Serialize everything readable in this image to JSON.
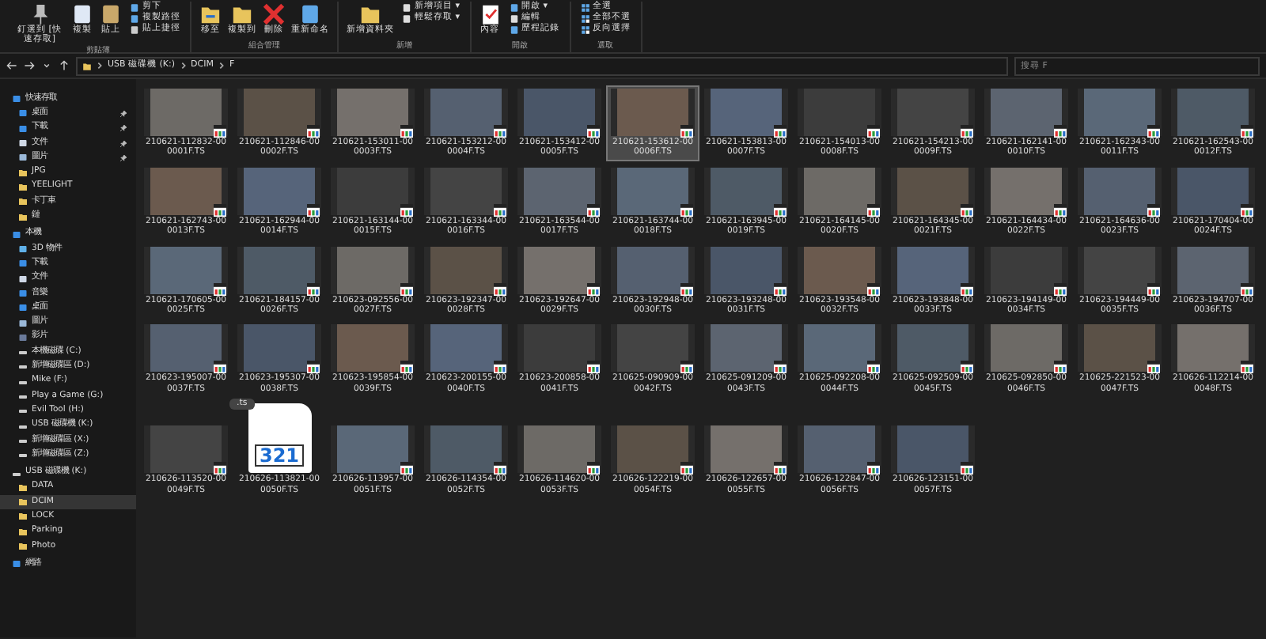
{
  "ribbon": {
    "groups": [
      {
        "label": "剪貼簿",
        "buttons": [
          {
            "kind": "large",
            "label": "釘選到 [快速存取]"
          },
          {
            "kind": "large",
            "label": "複製"
          },
          {
            "kind": "large",
            "label": "貼上"
          },
          {
            "kind": "small",
            "label": "剪下"
          },
          {
            "kind": "small",
            "label": "複製路徑"
          },
          {
            "kind": "small",
            "label": "貼上捷徑"
          }
        ]
      },
      {
        "label": "組合管理",
        "buttons": [
          {
            "kind": "large",
            "label": "移至"
          },
          {
            "kind": "large",
            "label": "複製到"
          },
          {
            "kind": "large",
            "label": "刪除"
          },
          {
            "kind": "large",
            "label": "重新命名"
          }
        ]
      },
      {
        "label": "新增",
        "buttons": [
          {
            "kind": "large",
            "label": "新增資料夾"
          },
          {
            "kind": "small",
            "label": "新增項目 ▾"
          },
          {
            "kind": "small",
            "label": "輕鬆存取 ▾"
          }
        ]
      },
      {
        "label": "開啟",
        "buttons": [
          {
            "kind": "large",
            "label": "內容"
          },
          {
            "kind": "small",
            "label": "開啟 ▾"
          },
          {
            "kind": "small",
            "label": "編輯"
          },
          {
            "kind": "small",
            "label": "歷程記錄"
          }
        ]
      },
      {
        "label": "選取",
        "buttons": [
          {
            "kind": "small",
            "label": "全選"
          },
          {
            "kind": "small",
            "label": "全部不選"
          },
          {
            "kind": "small",
            "label": "反向選擇"
          }
        ]
      }
    ]
  },
  "address_bar": {
    "path": [
      "USB 磁碟機 (K:)",
      "DCIM",
      "F"
    ],
    "search": {
      "placeholder": "搜尋 F"
    }
  },
  "sidebar": {
    "items": [
      {
        "kind": "header",
        "label": "快速存取",
        "selected": false,
        "pinned": false
      },
      {
        "kind": "item",
        "label": "桌面",
        "selected": false,
        "pinned": true
      },
      {
        "kind": "item",
        "label": "下載",
        "selected": false,
        "pinned": true
      },
      {
        "kind": "item",
        "label": "文件",
        "selected": false,
        "pinned": true
      },
      {
        "kind": "item",
        "label": "圖片",
        "selected": false,
        "pinned": true
      },
      {
        "kind": "folder",
        "label": "JPG",
        "selected": false,
        "pinned": false
      },
      {
        "kind": "folder",
        "label": "YEELIGHT",
        "selected": false,
        "pinned": false
      },
      {
        "kind": "folder",
        "label": "卡丁車",
        "selected": false,
        "pinned": false
      },
      {
        "kind": "folder",
        "label": "鏈",
        "selected": false,
        "pinned": false
      },
      {
        "kind": "header",
        "label": "本機",
        "selected": false,
        "pinned": false
      },
      {
        "kind": "item",
        "label": "3D 物件",
        "selected": false,
        "pinned": false
      },
      {
        "kind": "item",
        "label": "下載",
        "selected": false,
        "pinned": false
      },
      {
        "kind": "item",
        "label": "文件",
        "selected": false,
        "pinned": false
      },
      {
        "kind": "item",
        "label": "音樂",
        "selected": false,
        "pinned": false
      },
      {
        "kind": "item",
        "label": "桌面",
        "selected": false,
        "pinned": false
      },
      {
        "kind": "item",
        "label": "圖片",
        "selected": false,
        "pinned": false
      },
      {
        "kind": "item",
        "label": "影片",
        "selected": false,
        "pinned": false
      },
      {
        "kind": "drive",
        "label": "本機磁碟 (C:)",
        "selected": false,
        "pinned": false
      },
      {
        "kind": "drive",
        "label": "新增磁碟區 (D:)",
        "selected": false,
        "pinned": false
      },
      {
        "kind": "drive",
        "label": "Mike (F:)",
        "selected": false,
        "pinned": false
      },
      {
        "kind": "drive",
        "label": "Play a Game (G:)",
        "selected": false,
        "pinned": false
      },
      {
        "kind": "drive",
        "label": "Evil Tool (H:)",
        "selected": false,
        "pinned": false
      },
      {
        "kind": "drive",
        "label": "USB 磁碟機 (K:)",
        "selected": false,
        "pinned": false
      },
      {
        "kind": "drive",
        "label": "新增磁碟區 (X:)",
        "selected": false,
        "pinned": false
      },
      {
        "kind": "drive",
        "label": "新增磁碟區 (Z:)",
        "selected": false,
        "pinned": false
      },
      {
        "kind": "drive-header",
        "label": "USB 磁碟機 (K:)",
        "selected": false,
        "pinned": false
      },
      {
        "kind": "folder",
        "label": "DATA",
        "selected": false,
        "pinned": false
      },
      {
        "kind": "folder",
        "label": "DCIM",
        "selected": true,
        "pinned": false
      },
      {
        "kind": "folder",
        "label": "LOCK",
        "selected": false,
        "pinned": false
      },
      {
        "kind": "folder",
        "label": "Parking",
        "selected": false,
        "pinned": false
      },
      {
        "kind": "folder",
        "label": "Photo",
        "selected": false,
        "pinned": false
      },
      {
        "kind": "header",
        "label": "網路",
        "selected": false,
        "pinned": false
      }
    ]
  },
  "files": {
    "rows": [
      [
        {
          "kind": "video",
          "name": "210621-112832-000001F.TS",
          "selected": false
        },
        {
          "kind": "video",
          "name": "210621-112846-000002F.TS",
          "selected": false
        },
        {
          "kind": "video",
          "name": "210621-153011-000003F.TS",
          "selected": false
        },
        {
          "kind": "video",
          "name": "210621-153212-000004F.TS",
          "selected": false
        },
        {
          "kind": "video",
          "name": "210621-153412-000005F.TS",
          "selected": false
        },
        {
          "kind": "video",
          "name": "210621-153612-000006F.TS",
          "selected": true
        },
        {
          "kind": "video",
          "name": "210621-153813-000007F.TS",
          "selected": false
        },
        {
          "kind": "video",
          "name": "210621-154013-000008F.TS",
          "selected": false
        },
        {
          "kind": "video",
          "name": "210621-154213-000009F.TS",
          "selected": false
        },
        {
          "kind": "video",
          "name": "210621-162141-000010F.TS",
          "selected": false
        },
        {
          "kind": "video",
          "name": "210621-162343-000011F.TS",
          "selected": false
        },
        {
          "kind": "video",
          "name": "210621-162543-000012F.TS",
          "selected": false
        }
      ],
      [
        {
          "kind": "video",
          "name": "210621-162743-000013F.TS",
          "selected": false
        },
        {
          "kind": "video",
          "name": "210621-162944-000014F.TS",
          "selected": false
        },
        {
          "kind": "video",
          "name": "210621-163144-000015F.TS",
          "selected": false
        },
        {
          "kind": "video",
          "name": "210621-163344-000016F.TS",
          "selected": false
        },
        {
          "kind": "video",
          "name": "210621-163544-000017F.TS",
          "selected": false
        },
        {
          "kind": "video",
          "name": "210621-163744-000018F.TS",
          "selected": false
        },
        {
          "kind": "video",
          "name": "210621-163945-000019F.TS",
          "selected": false
        },
        {
          "kind": "video",
          "name": "210621-164145-000020F.TS",
          "selected": false
        },
        {
          "kind": "video",
          "name": "210621-164345-000021F.TS",
          "selected": false
        },
        {
          "kind": "video",
          "name": "210621-164434-000022F.TS",
          "selected": false
        },
        {
          "kind": "video",
          "name": "210621-164636-000023F.TS",
          "selected": false
        },
        {
          "kind": "video",
          "name": "210621-170404-000024F.TS",
          "selected": false
        }
      ],
      [
        {
          "kind": "video",
          "name": "210621-170605-000025F.TS",
          "selected": false
        },
        {
          "kind": "video",
          "name": "210621-184157-000026F.TS",
          "selected": false
        },
        {
          "kind": "video",
          "name": "210623-092556-000027F.TS",
          "selected": false
        },
        {
          "kind": "video",
          "name": "210623-192347-000028F.TS",
          "selected": false
        },
        {
          "kind": "video",
          "name": "210623-192647-000029F.TS",
          "selected": false
        },
        {
          "kind": "video",
          "name": "210623-192948-000030F.TS",
          "selected": false
        },
        {
          "kind": "video",
          "name": "210623-193248-000031F.TS",
          "selected": false
        },
        {
          "kind": "video",
          "name": "210623-193548-000032F.TS",
          "selected": false
        },
        {
          "kind": "video",
          "name": "210623-193848-000033F.TS",
          "selected": false
        },
        {
          "kind": "video",
          "name": "210623-194149-000034F.TS",
          "selected": false
        },
        {
          "kind": "video",
          "name": "210623-194449-000035F.TS",
          "selected": false
        },
        {
          "kind": "video",
          "name": "210623-194707-000036F.TS",
          "selected": false
        }
      ],
      [
        {
          "kind": "video",
          "name": "210623-195007-000037F.TS",
          "selected": false
        },
        {
          "kind": "video",
          "name": "210623-195307-000038F.TS",
          "selected": false
        },
        {
          "kind": "video",
          "name": "210623-195854-000039F.TS",
          "selected": false
        },
        {
          "kind": "video",
          "name": "210623-200155-000040F.TS",
          "selected": false
        },
        {
          "kind": "video",
          "name": "210623-200858-000041F.TS",
          "selected": false
        },
        {
          "kind": "video",
          "name": "210625-090909-000042F.TS",
          "selected": false
        },
        {
          "kind": "video",
          "name": "210625-091209-000043F.TS",
          "selected": false
        },
        {
          "kind": "video",
          "name": "210625-092208-000044F.TS",
          "selected": false
        },
        {
          "kind": "video",
          "name": "210625-092509-000045F.TS",
          "selected": false
        },
        {
          "kind": "video",
          "name": "210625-092850-000046F.TS",
          "selected": false
        },
        {
          "kind": "video",
          "name": "210625-221523-000047F.TS",
          "selected": false
        },
        {
          "kind": "video",
          "name": "210626-112214-000048F.TS",
          "selected": false
        }
      ],
      [
        {
          "kind": "video",
          "name": "210626-113520-000049F.TS",
          "selected": false
        },
        {
          "kind": "app-icon",
          "name": "210626-113821-000050F.TS",
          "selected": false,
          "icon_text": "321",
          "tag": ".ts"
        },
        {
          "kind": "video",
          "name": "210626-113957-000051F.TS",
          "selected": false
        },
        {
          "kind": "video",
          "name": "210626-114354-000052F.TS",
          "selected": false
        },
        {
          "kind": "video",
          "name": "210626-114620-000053F.TS",
          "selected": false
        },
        {
          "kind": "video",
          "name": "210626-122219-000054F.TS",
          "selected": false
        },
        {
          "kind": "video",
          "name": "210626-122657-000055F.TS",
          "selected": false
        },
        {
          "kind": "video",
          "name": "210626-122847-000056F.TS",
          "selected": false
        },
        {
          "kind": "video",
          "name": "210626-123151-000057F.TS",
          "selected": false
        }
      ]
    ]
  }
}
